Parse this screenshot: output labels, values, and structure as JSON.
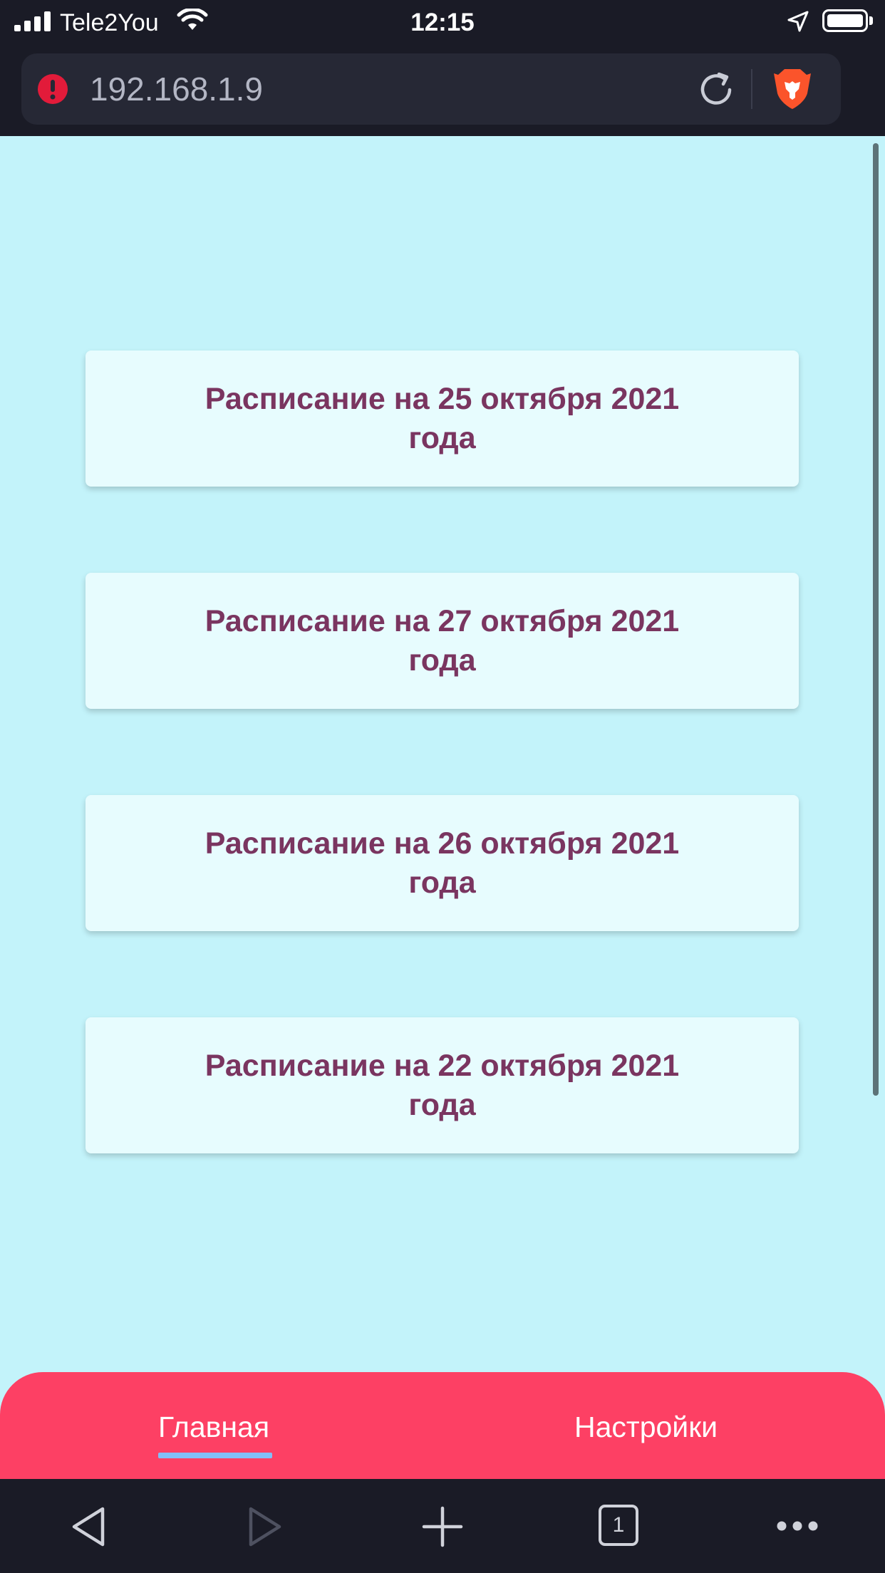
{
  "status_bar": {
    "carrier": "Tele2You",
    "time": "12:15"
  },
  "browser": {
    "url": "192.168.1.9",
    "tab_count": "1"
  },
  "schedule_list": {
    "items": [
      {
        "label": "Расписание на 25 октября 2021 года"
      },
      {
        "label": "Расписание на 27 октября 2021 года"
      },
      {
        "label": "Расписание на 26 октября 2021 года"
      },
      {
        "label": "Расписание на 22 октября 2021 года"
      }
    ]
  },
  "bottom_nav": {
    "tabs": [
      {
        "label": "Главная",
        "active": true
      },
      {
        "label": "Настройки",
        "active": false
      }
    ]
  },
  "colors": {
    "page_background": "#c3f3fa",
    "card_background": "#e7fcfe",
    "card_text": "#7a3560",
    "nav_background": "#fd4064",
    "active_tab_indicator": "#82bff8"
  },
  "icons": [
    "signal-icon",
    "wifi-icon",
    "location-arrow-icon",
    "battery-icon",
    "warning-icon",
    "reload-icon",
    "brave-lion-icon",
    "back-icon",
    "forward-icon",
    "plus-icon",
    "tabs-icon",
    "more-icon"
  ]
}
